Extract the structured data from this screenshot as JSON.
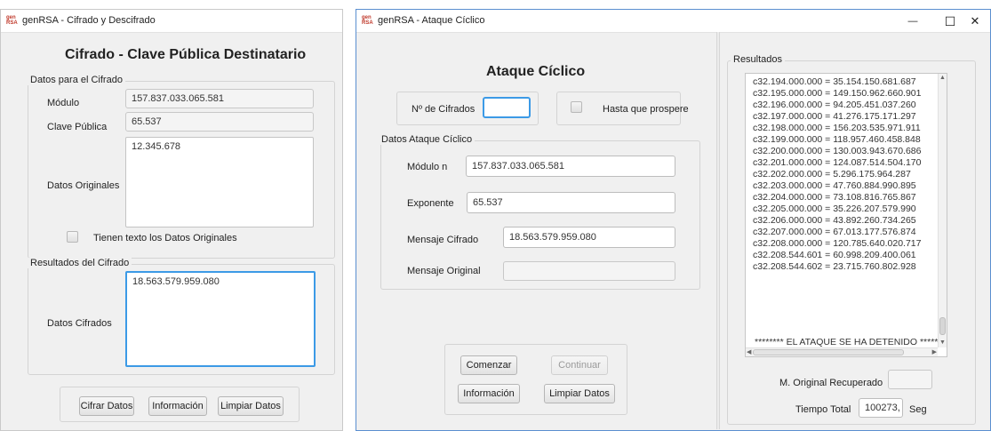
{
  "window1": {
    "title": "genRSA - Cifrado y Descifrado",
    "app_icon_text": "gen\nRSA",
    "heading": "Cifrado - Clave Pública Destinatario",
    "datos_group_title": "Datos para el Cifrado",
    "modulo_label": "Módulo",
    "modulo_value": "157.837.033.065.581",
    "clave_label": "Clave Pública",
    "clave_value": "65.537",
    "datos_orig_label": "Datos Originales",
    "datos_orig_value": "12.345.678",
    "checkbox_label": "Tienen texto los Datos Originales",
    "resultados_group_title": "Resultados del Cifrado",
    "datos_cifrados_label": "Datos Cifrados",
    "datos_cifrados_value": "18.563.579.959.080",
    "btn_cifrar": "Cifrar Datos",
    "btn_info": "Información",
    "btn_limpiar": "Limpiar Datos"
  },
  "window2": {
    "title": "genRSA - Ataque Cíclico",
    "app_icon_text": "gen\nRSA",
    "caption_minimize": "—",
    "caption_maximize": "☐",
    "caption_close": "✕",
    "heading": "Ataque Cíclico",
    "num_cifrados_label": "Nº de Cifrados",
    "num_cifrados_value": "",
    "hasta_label": "Hasta que prospere",
    "ataque_group_title": "Datos Ataque Cíclico",
    "modulo_label": "Módulo n",
    "modulo_value": "157.837.033.065.581",
    "exponente_label": "Exponente",
    "exponente_value": "65.537",
    "mensaje_cifrado_label": "Mensaje Cifrado",
    "mensaje_cifrado_value": "18.563.579.959.080",
    "mensaje_original_label": "Mensaje Original",
    "mensaje_original_value": "",
    "btn_comenzar": "Comenzar",
    "btn_continuar": "Continuar",
    "btn_info": "Información",
    "btn_limpiar": "Limpiar Datos",
    "resultados_title": "Resultados",
    "results": [
      "c32.194.000.000 = 35.154.150.681.687",
      "c32.195.000.000 = 149.150.962.660.901",
      "c32.196.000.000 = 94.205.451.037.260",
      "c32.197.000.000 = 41.276.175.171.297",
      "c32.198.000.000 = 156.203.535.971.911",
      "c32.199.000.000 = 118.957.460.458.848",
      "c32.200.000.000 = 130.003.943.670.686",
      "c32.201.000.000 = 124.087.514.504.170",
      "c32.202.000.000 = 5.296.175.964.287",
      "c32.203.000.000 = 47.760.884.990.895",
      "c32.204.000.000 = 73.108.816.765.867",
      "c32.205.000.000 = 35.226.207.579.990",
      "c32.206.000.000 = 43.892.260.734.265",
      "c32.207.000.000 = 67.013.177.576.874",
      "c32.208.000.000 = 120.785.640.020.717",
      "c32.208.544.601 = 60.998.209.400.061",
      "c32.208.544.602 = 23.715.760.802.928"
    ],
    "results_status": "******** EL ATAQUE SE HA DETENIDO ********",
    "m_original_label": "M. Original Recuperado",
    "m_original_value": "",
    "tiempo_label": "Tiempo Total",
    "tiempo_value": "100273,",
    "seg_label": "Seg"
  }
}
